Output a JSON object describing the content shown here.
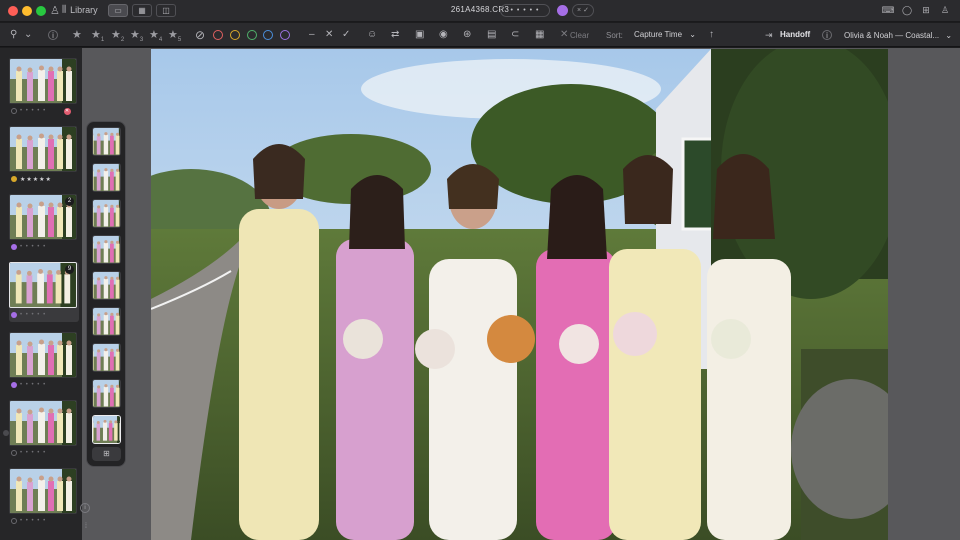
{
  "titlebar": {
    "library_label": "Library",
    "filename": "261A4368.CR3",
    "rating_dots": "• • • • •",
    "color_label_hex": "#a56ee6",
    "flag_controls": "× ✓"
  },
  "toolbar": {
    "stars": [
      "1",
      "2",
      "3",
      "4",
      "5"
    ],
    "color_rings": [
      "#e06060",
      "#d8a82a",
      "#4fb06a",
      "#4a8fdc",
      "#9b72e0"
    ],
    "clear_label": "Clear",
    "sort_label": "Sort:",
    "sort_value": "Capture Time",
    "handoff_label": "Handoff",
    "project_label": "Olivia & Noah — Coastal..."
  },
  "sidebar": {
    "items": [
      {
        "rating": "• • • • •",
        "flag": "rejected",
        "badge": ""
      },
      {
        "rating": "★★★★★",
        "color": "#d8a82a",
        "badge": ""
      },
      {
        "rating": "• • • • •",
        "color": "#a56ee6",
        "badge": "2"
      },
      {
        "rating": "• • • • •",
        "color": "#a56ee6",
        "badge": "9",
        "selected": true
      },
      {
        "rating": "• • • • •",
        "color": "#a56ee6",
        "badge": ""
      },
      {
        "rating": "• • • • •",
        "color": "",
        "badge": ""
      },
      {
        "rating": "• • • • •",
        "color": "",
        "badge": ""
      }
    ]
  },
  "stack": {
    "count": 9,
    "selected_index": 8
  }
}
